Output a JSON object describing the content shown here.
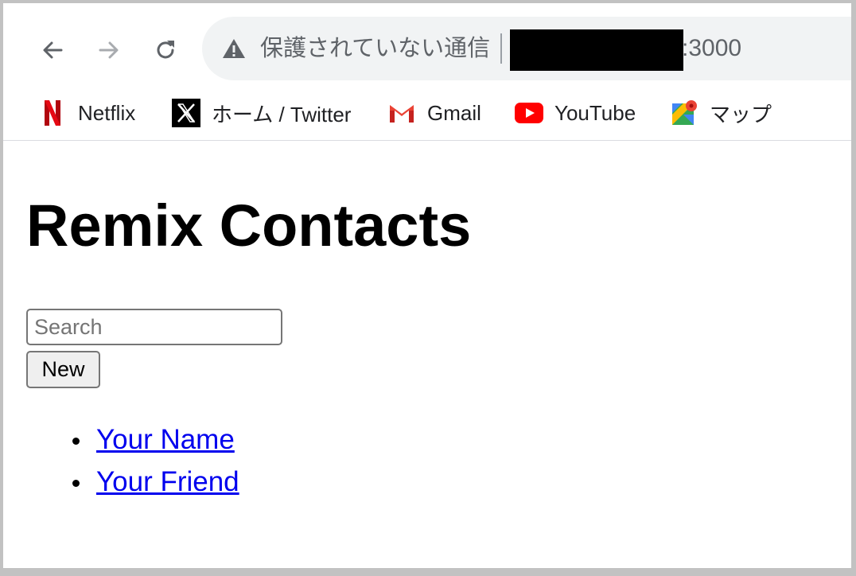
{
  "browser": {
    "security_text": "保護されていない通信",
    "url_port": ":3000",
    "bookmarks": [
      {
        "label": "Netflix",
        "icon": "netflix-icon"
      },
      {
        "label": "ホーム / Twitter",
        "icon": "x-twitter-icon"
      },
      {
        "label": "Gmail",
        "icon": "gmail-icon"
      },
      {
        "label": "YouTube",
        "icon": "youtube-icon"
      },
      {
        "label": "マップ",
        "icon": "google-maps-icon"
      }
    ],
    "colors": {
      "chrome_bg": "#ffffff",
      "omnibox_bg": "#f1f3f4",
      "text": "#5f6368"
    }
  },
  "page": {
    "title": "Remix Contacts",
    "search_placeholder": "Search",
    "new_button": "New",
    "contacts": [
      "Your Name",
      "Your Friend"
    ],
    "colors": {
      "link": "#0000ee"
    }
  }
}
